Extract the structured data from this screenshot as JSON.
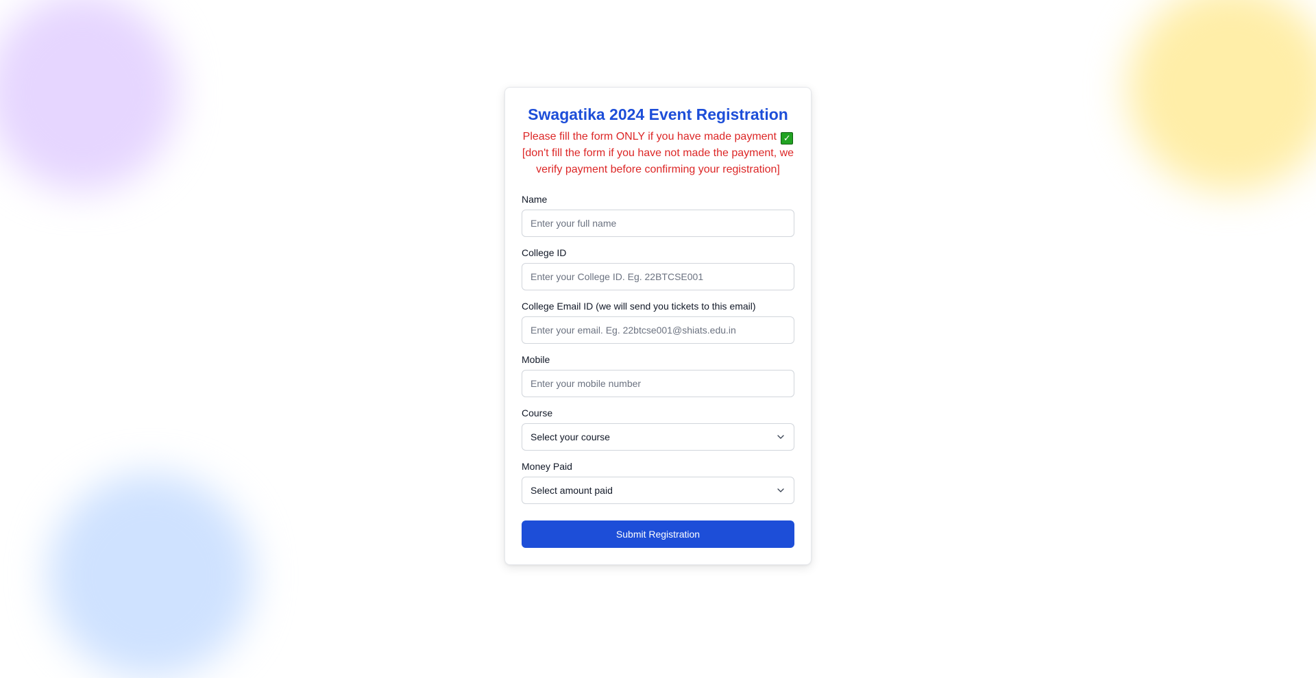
{
  "form": {
    "title": "Swagatika 2024 Event Registration",
    "notice_line": "Please fill the form ONLY if you have made payment",
    "notice_check": "✓",
    "notice_detail": "[don't fill the form if you have not made the payment, we verify payment before confirming your registration]",
    "fields": {
      "name": {
        "label": "Name",
        "placeholder": "Enter your full name",
        "value": ""
      },
      "college_id": {
        "label": "College ID",
        "placeholder": "Enter your College ID. Eg. 22BTCSE001",
        "value": ""
      },
      "email": {
        "label": "College Email ID (we will send you tickets to this email)",
        "placeholder": "Enter your email. Eg. 22btcse001@shiats.edu.in",
        "value": ""
      },
      "mobile": {
        "label": "Mobile",
        "placeholder": "Enter your mobile number",
        "value": ""
      },
      "course": {
        "label": "Course",
        "selected": "Select your course"
      },
      "money_paid": {
        "label": "Money Paid",
        "selected": "Select amount paid"
      }
    },
    "submit_label": "Submit Registration"
  },
  "colors": {
    "accent": "#1d4ed8",
    "notice": "#dc2626",
    "blob_purple": "#e6d6ff",
    "blob_yellow": "#ffeea8",
    "blob_blue": "#cfe2ff"
  },
  "icons": {
    "notice": "check-mark-icon",
    "select": "chevron-down-icon"
  }
}
